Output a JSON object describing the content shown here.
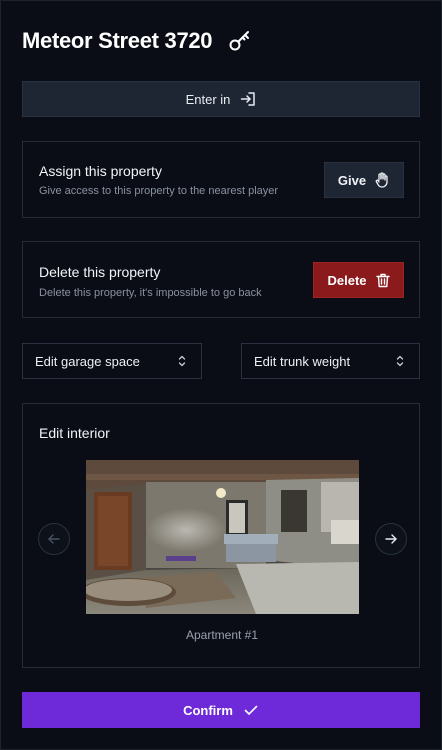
{
  "header": {
    "title": "Meteor Street 3720",
    "icon": "key-icon"
  },
  "enter": {
    "label": "Enter in",
    "icon": "enter-arrow-icon"
  },
  "assign": {
    "title": "Assign this property",
    "subtitle": "Give access to this property to the nearest player",
    "button_label": "Give",
    "button_icon": "hand-icon"
  },
  "delete": {
    "title": "Delete this property",
    "subtitle": "Delete this property, it's impossible to go back",
    "button_label": "Delete",
    "button_icon": "trash-icon",
    "accent": "#8a1a1c"
  },
  "selects": {
    "garage": {
      "label": "Edit garage space",
      "icon": "chevron-updown-icon"
    },
    "trunk": {
      "label": "Edit trunk weight",
      "icon": "chevron-updown-icon"
    }
  },
  "interior": {
    "title": "Edit interior",
    "caption": "Apartment #1",
    "prev_icon": "arrow-left-icon",
    "next_icon": "arrow-right-icon"
  },
  "confirm": {
    "label": "Confirm",
    "icon": "check-icon",
    "accent": "#6e2ad8"
  }
}
